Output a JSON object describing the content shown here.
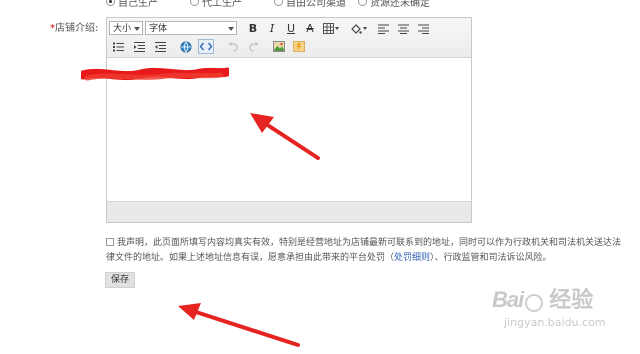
{
  "supply_radios": [
    {
      "label": "自己生产",
      "checked": true
    },
    {
      "label": "代工生产",
      "checked": false
    },
    {
      "label": "自由公司渠道",
      "checked": false
    },
    {
      "label": "货源还未确定",
      "checked": false
    }
  ],
  "intro_field": {
    "required_mark": "*",
    "label": "店铺介绍:"
  },
  "editor": {
    "font_size_select": "大小",
    "font_family_select": "字体",
    "bold": "B",
    "italic": "I",
    "underline": "U",
    "strikethrough": "A"
  },
  "declaration": {
    "checked": false,
    "text_before_link": "我声明，此页面所填写内容均真实有效，特别是经营地址为店铺最新可联系到的地址，同时可以作为行政机关和司法机关送达法律文件的地址。如果上述地址信息有误，愿意承担由此带来的平台处罚（",
    "link_text": "处罚细则",
    "text_after_link": "）、行政监管和司法诉讼风险。"
  },
  "save_button": "保存",
  "watermark": {
    "brand_left": "Bai",
    "brand_right": "经验",
    "url": "jingyan.baidu.com"
  },
  "colors": {
    "arrow": "#e52421",
    "scribble": "#e8191b",
    "link": "#2f5fb3"
  }
}
